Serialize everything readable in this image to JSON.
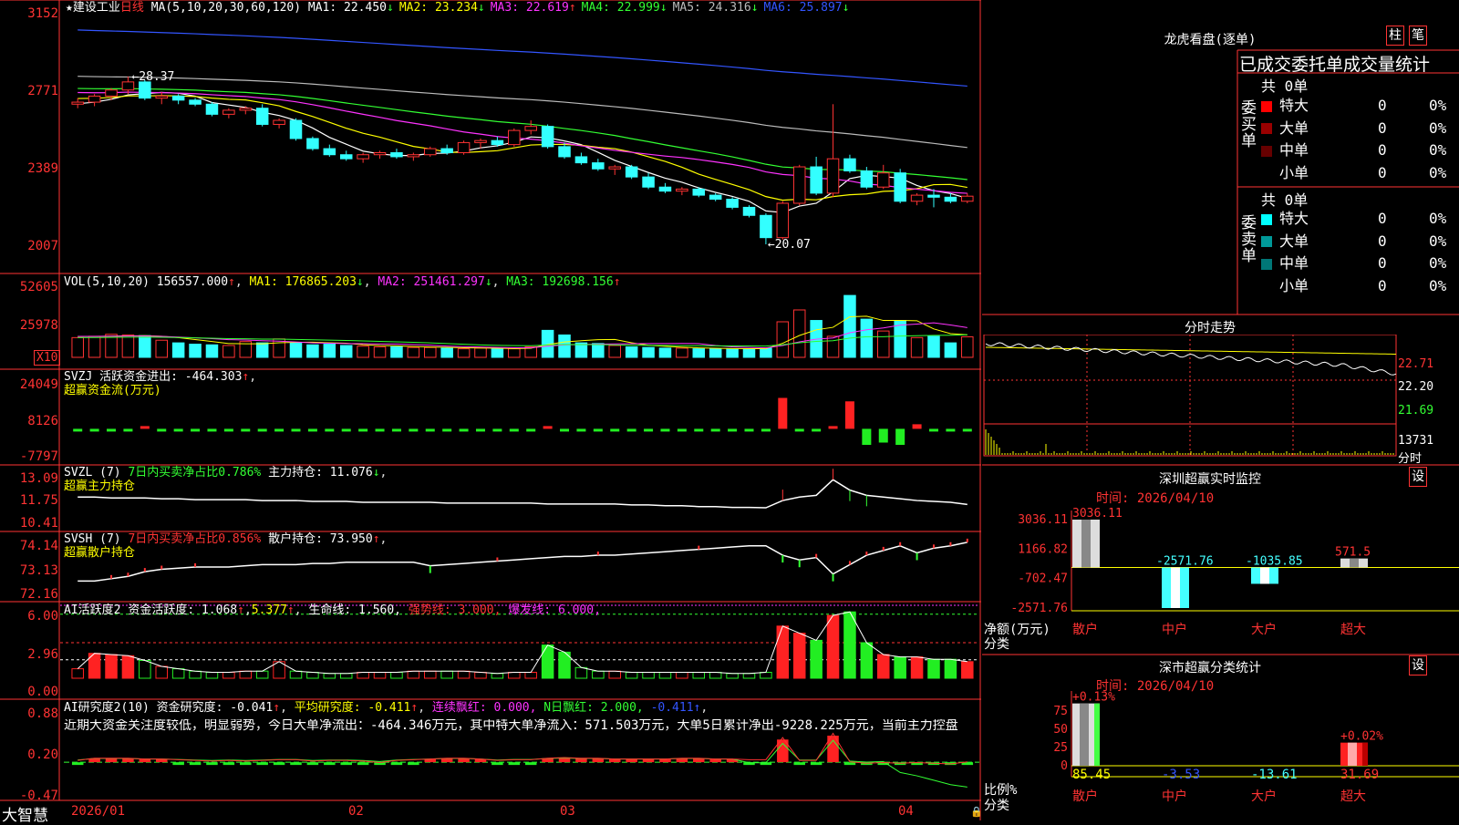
{
  "stock": {
    "star": "★",
    "name": "建设工业",
    "period": "日线"
  },
  "main_legend": {
    "ma_spec": "MA(5,10,20,30,60,120)",
    "items": [
      {
        "label": "MA1: 22.450",
        "arrow": "↓",
        "color": "#ffffff"
      },
      {
        "label": "MA2: 23.234",
        "arrow": "↓",
        "color": "#ffff00"
      },
      {
        "label": "MA3: 22.619",
        "arrow": "↑",
        "color": "#ff33ff"
      },
      {
        "label": "MA4: 22.999",
        "arrow": "↓",
        "color": "#33ff33"
      },
      {
        "label": "MA5: 24.316",
        "arrow": "↓",
        "color": "#bbbbbb"
      },
      {
        "label": "MA6: 25.897",
        "arrow": "↓",
        "color": "#3355ff"
      }
    ],
    "high_label": "28.37",
    "low_label": "20.07"
  },
  "y_ticks": {
    "main": [
      "3152",
      "2771",
      "2389",
      "2007"
    ],
    "vol": [
      "52605",
      "25978"
    ],
    "vol_unit": "X10",
    "svzj": [
      "24049",
      "8126",
      "-7797"
    ],
    "svzl": [
      "13.09",
      "11.75",
      "10.41"
    ],
    "svsh": [
      "74.14",
      "73.13",
      "72.16"
    ],
    "ai1": [
      "6.00",
      "2.96",
      "0.00"
    ],
    "ai2": [
      "0.88",
      "0.20",
      "-0.47"
    ]
  },
  "x_ticks": [
    "2026/01",
    "02",
    "03",
    "04"
  ],
  "brand": "大智慧",
  "vol_legend": {
    "spec": "VOL(5,10,20)",
    "value": "156557.000",
    "ma1": "MA1: 176865.203",
    "ma2": "MA2: 251461.297",
    "ma3": "MA3: 192698.156"
  },
  "svzj_legend": {
    "spec": "SVZJ",
    "text": "活跃资金进出: -464.303",
    "sub": "超赢资金流(万元)"
  },
  "svzl_legend": {
    "spec": "SVZL (7)",
    "t1": "7日内买卖净占比0.786%",
    "t2": "主力持仓: 11.076",
    "sub": "超赢主力持仓"
  },
  "svsh_legend": {
    "spec": "SVSH (7)",
    "t1": "7日内买卖净占比0.856%",
    "t2": "散户持仓: 73.950",
    "sub": "超赢散户持仓"
  },
  "ai1_legend": {
    "spec": "AI活跃度2",
    "t1": "资金活跃度: 1.068",
    "t2": "5.377",
    "t3": "生命线: 1.560,",
    "t4": "强势线: 3.000,",
    "t5": "爆发线: 6.000,"
  },
  "ai2_legend": {
    "spec": "AI研究度2(10)",
    "t1": "资金研究度: -0.041",
    "t2": "平均研究度: -0.411",
    "t3": "连续飘红: 0.000,",
    "t4": "N日飘红: 2.000,",
    "t5": "-0.411",
    "comment": "近期大资金关注度较低，明显弱势，今日大单净流出：-464.346万元，其中特大单净流入：571.503万元，大单5日累计净出-9228.225万元，当前主力控盘"
  },
  "right": {
    "lhb_title": "龙虎看盘(逐单)",
    "btn_bar": "柱",
    "btn_line": "笔",
    "stats_title": "已成交委托单成交量统计",
    "buy_label": "委买单",
    "sell_label": "委卖单",
    "buy_total": "共 0单",
    "sell_total": "共 0单",
    "buy_rows": [
      {
        "name": "特大",
        "count": "0",
        "pct": "0%",
        "color": "#ff0000"
      },
      {
        "name": "大单",
        "count": "0",
        "pct": "0%",
        "color": "#990000"
      },
      {
        "name": "中单",
        "count": "0",
        "pct": "0%",
        "color": "#660000"
      },
      {
        "name": "小单",
        "count": "0",
        "pct": "0%",
        "color": "#000000"
      }
    ],
    "sell_rows": [
      {
        "name": "特大",
        "count": "0",
        "pct": "0%",
        "color": "#00ffff"
      },
      {
        "name": "大单",
        "count": "0",
        "pct": "0%",
        "color": "#009999"
      },
      {
        "name": "中单",
        "count": "0",
        "pct": "0%",
        "color": "#007777"
      },
      {
        "name": "小单",
        "count": "0",
        "pct": "0%",
        "color": "#000000"
      }
    ],
    "intraday_title": "分时走势",
    "intraday_ticks": [
      "22.71",
      "22.20",
      "21.69"
    ],
    "intraday_vol_tick": "13731",
    "intraday_vol_unit": "分时",
    "sz_title": "深圳超赢实时监控",
    "sz_date": "时间: 2026/04/10",
    "sz_yticks": [
      "3036.11",
      "1166.82",
      "-702.47",
      "-2571.76"
    ],
    "sz_unit": "净额(万元)",
    "cat_label": "分类",
    "sz_classify_title": "深市超赢分类统计",
    "classify_date": "时间: 2026/04/10",
    "classify_yticks": [
      "75",
      "50",
      "25",
      "0"
    ],
    "ratio_label": "比例%",
    "set_btn": "设"
  },
  "chart_data": [
    {
      "type": "candlestick",
      "title": "建设工业 日线",
      "x": [
        "2026/01",
        "02",
        "03",
        "04"
      ],
      "ohlc": [
        [
          27.0,
          27.3,
          26.8,
          27.1
        ],
        [
          27.1,
          27.5,
          26.9,
          27.4
        ],
        [
          27.4,
          27.8,
          27.2,
          27.7
        ],
        [
          27.7,
          28.37,
          27.5,
          28.1
        ],
        [
          28.1,
          28.2,
          27.2,
          27.3
        ],
        [
          27.3,
          27.6,
          27.0,
          27.4
        ],
        [
          27.4,
          27.5,
          27.0,
          27.2
        ],
        [
          27.2,
          27.3,
          26.9,
          27.0
        ],
        [
          27.0,
          27.1,
          26.4,
          26.5
        ],
        [
          26.5,
          26.8,
          26.3,
          26.7
        ],
        [
          26.7,
          26.9,
          26.5,
          26.8
        ],
        [
          26.8,
          27.0,
          25.9,
          26.0
        ],
        [
          26.0,
          26.3,
          25.8,
          26.2
        ],
        [
          26.2,
          26.3,
          25.2,
          25.3
        ],
        [
          25.3,
          25.4,
          24.7,
          24.8
        ],
        [
          24.8,
          25.0,
          24.4,
          24.5
        ],
        [
          24.5,
          24.7,
          24.2,
          24.3
        ],
        [
          24.3,
          24.6,
          24.1,
          24.5
        ],
        [
          24.5,
          24.7,
          24.3,
          24.6
        ],
        [
          24.6,
          24.8,
          24.3,
          24.4
        ],
        [
          24.4,
          24.6,
          24.2,
          24.5
        ],
        [
          24.5,
          24.9,
          24.4,
          24.8
        ],
        [
          24.8,
          25.0,
          24.5,
          24.6
        ],
        [
          24.6,
          25.2,
          24.5,
          25.1
        ],
        [
          25.1,
          25.3,
          24.8,
          25.2
        ],
        [
          25.2,
          25.4,
          24.9,
          25.0
        ],
        [
          25.0,
          25.8,
          24.9,
          25.7
        ],
        [
          25.7,
          26.2,
          25.5,
          25.9
        ],
        [
          25.9,
          26.0,
          24.8,
          24.9
        ],
        [
          24.9,
          25.1,
          24.3,
          24.4
        ],
        [
          24.4,
          24.6,
          24.0,
          24.1
        ],
        [
          24.1,
          24.3,
          23.7,
          23.8
        ],
        [
          23.8,
          24.0,
          23.5,
          23.9
        ],
        [
          23.9,
          24.0,
          23.3,
          23.4
        ],
        [
          23.4,
          23.6,
          22.8,
          22.9
        ],
        [
          22.9,
          23.1,
          22.6,
          22.7
        ],
        [
          22.7,
          22.9,
          22.5,
          22.8
        ],
        [
          22.8,
          22.9,
          22.4,
          22.5
        ],
        [
          22.5,
          22.6,
          22.2,
          22.3
        ],
        [
          22.3,
          22.4,
          21.8,
          21.9
        ],
        [
          21.9,
          22.0,
          21.4,
          21.5
        ],
        [
          21.5,
          21.6,
          20.07,
          20.4
        ],
        [
          20.4,
          22.2,
          20.3,
          22.1
        ],
        [
          22.1,
          24.0,
          22.0,
          23.9
        ],
        [
          23.9,
          24.4,
          22.5,
          22.6
        ],
        [
          22.6,
          27.0,
          22.4,
          24.3
        ],
        [
          24.3,
          24.5,
          23.6,
          23.7
        ],
        [
          23.7,
          23.9,
          22.8,
          22.9
        ],
        [
          22.9,
          24.0,
          22.8,
          23.6
        ],
        [
          23.6,
          23.8,
          22.1,
          22.2
        ],
        [
          22.2,
          22.6,
          22.0,
          22.5
        ],
        [
          22.5,
          22.8,
          21.9,
          22.4
        ],
        [
          22.4,
          22.6,
          22.1,
          22.2
        ],
        [
          22.2,
          22.6,
          22.1,
          22.45
        ]
      ],
      "ylabel": "",
      "ylim": [
        20.07,
        31.52
      ]
    },
    {
      "type": "bar",
      "title": "VOL(5,10,20)",
      "values": [
        15000,
        16000,
        17500,
        17000,
        16500,
        13000,
        11000,
        10000,
        9500,
        9000,
        12000,
        11000,
        14000,
        11000,
        9500,
        10000,
        9000,
        8500,
        8000,
        8000,
        7500,
        7500,
        7000,
        6500,
        7000,
        6500,
        6500,
        8000,
        20500,
        17000,
        11000,
        10500,
        9000,
        8000,
        7500,
        7000,
        7000,
        6500,
        6500,
        6500,
        6500,
        7000,
        27000,
        36000,
        28000,
        16000,
        47000,
        29000,
        20000,
        28000,
        15000,
        16000,
        11000,
        15600
      ],
      "unit": "X10",
      "ylim": [
        0,
        52605
      ]
    },
    {
      "type": "bar",
      "title": "SVZJ",
      "values": [
        -150,
        -150,
        -150,
        -1000,
        500,
        -150,
        -300,
        -150,
        -150,
        -150,
        -150,
        -150,
        -150,
        -150,
        -150,
        -150,
        -150,
        -150,
        -150,
        -150,
        -150,
        -150,
        -150,
        -150,
        -150,
        -150,
        -150,
        -150,
        1200,
        -150,
        -150,
        -300,
        -150,
        -150,
        -150,
        -150,
        -150,
        -150,
        -150,
        -150,
        -150,
        -150,
        13500,
        -150,
        -300,
        1000,
        12000,
        -7000,
        -6000,
        -7000,
        2000,
        -1000,
        -1000,
        -464
      ]
    },
    {
      "type": "line",
      "title": "SVZL",
      "values": [
        11.5,
        11.5,
        11.45,
        11.45,
        11.45,
        11.4,
        11.4,
        11.35,
        11.35,
        11.35,
        11.35,
        11.3,
        11.3,
        11.3,
        11.25,
        11.25,
        11.25,
        11.2,
        11.2,
        11.2,
        11.2,
        11.2,
        11.15,
        11.15,
        11.15,
        11.15,
        11.15,
        11.15,
        11.1,
        11.1,
        11.1,
        11.1,
        11.1,
        11.05,
        11.05,
        11.0,
        11.0,
        10.95,
        10.95,
        10.9,
        10.9,
        10.88,
        11.3,
        11.5,
        11.6,
        12.5,
        11.9,
        11.6,
        11.5,
        11.4,
        11.3,
        11.25,
        11.2,
        11.076
      ],
      "ylim": [
        10.41,
        13.09
      ]
    },
    {
      "type": "line",
      "title": "SVSH",
      "values": [
        72.3,
        72.3,
        72.4,
        72.5,
        72.7,
        72.8,
        72.85,
        72.9,
        72.9,
        72.9,
        72.95,
        73.0,
        73.0,
        73.0,
        73.05,
        73.05,
        73.1,
        73.1,
        73.1,
        73.1,
        73.1,
        72.95,
        73.0,
        73.05,
        73.1,
        73.15,
        73.2,
        73.25,
        73.3,
        73.35,
        73.35,
        73.4,
        73.4,
        73.45,
        73.5,
        73.55,
        73.6,
        73.65,
        73.7,
        73.75,
        73.8,
        73.8,
        73.4,
        73.2,
        73.3,
        72.6,
        73.0,
        73.4,
        73.6,
        73.8,
        73.5,
        73.7,
        73.8,
        73.95
      ],
      "ylim": [
        72.16,
        74.14
      ]
    },
    {
      "type": "bar",
      "title": "AI活跃度2",
      "values": [
        0.8,
        2.1,
        2.0,
        1.9,
        1.5,
        1.0,
        0.8,
        0.6,
        0.5,
        0.5,
        0.6,
        0.6,
        1.4,
        0.6,
        0.5,
        0.4,
        0.4,
        0.5,
        0.5,
        0.5,
        0.6,
        0.6,
        0.6,
        0.6,
        0.5,
        0.4,
        0.5,
        0.5,
        2.8,
        2.2,
        0.9,
        0.6,
        0.6,
        0.5,
        0.5,
        0.5,
        0.5,
        0.5,
        0.5,
        0.4,
        0.4,
        0.5,
        4.4,
        3.8,
        3.2,
        5.3,
        5.6,
        3.0,
        2.0,
        1.8,
        1.8,
        1.6,
        1.6,
        1.4
      ],
      "ylim": [
        0,
        6.0
      ]
    },
    {
      "type": "bar",
      "title": "AI研究度2(10)",
      "values": [
        -0.02,
        0.01,
        0.01,
        0.01,
        0.0,
        0.0,
        -0.01,
        -0.02,
        -0.03,
        -0.02,
        -0.03,
        -0.02,
        -0.01,
        -0.01,
        -0.03,
        -0.02,
        -0.02,
        -0.03,
        -0.05,
        -0.02,
        -0.01,
        0.0,
        0.01,
        0.01,
        0.0,
        -0.02,
        -0.01,
        -0.01,
        0.01,
        0.02,
        0.01,
        0.01,
        0.0,
        0.0,
        0.0,
        0.0,
        0.01,
        0.01,
        0.0,
        0.0,
        -0.01,
        -0.01,
        0.3,
        -0.02,
        -0.02,
        0.36,
        -0.04,
        -0.06,
        -0.05,
        -0.06,
        -0.05,
        -0.06,
        -0.07,
        -0.041
      ],
      "ylim": [
        -0.47,
        0.88
      ]
    },
    {
      "type": "bar",
      "title": "深圳超赢实时监控",
      "categories": [
        "散户",
        "中户",
        "大户",
        "超大"
      ],
      "values": [
        3036.11,
        -2571.76,
        -1035.85,
        571.5
      ],
      "ylim": [
        -2571.76,
        3036.11
      ]
    },
    {
      "type": "bar",
      "title": "深市超赢分类统计",
      "categories": [
        "散户",
        "中户",
        "大户",
        "超大"
      ],
      "values": [
        85.45,
        -3.53,
        -13.61,
        31.69
      ],
      "changes": [
        "+0.13%",
        "",
        "",
        "+0.02%"
      ],
      "ylim": [
        0,
        100
      ]
    }
  ]
}
